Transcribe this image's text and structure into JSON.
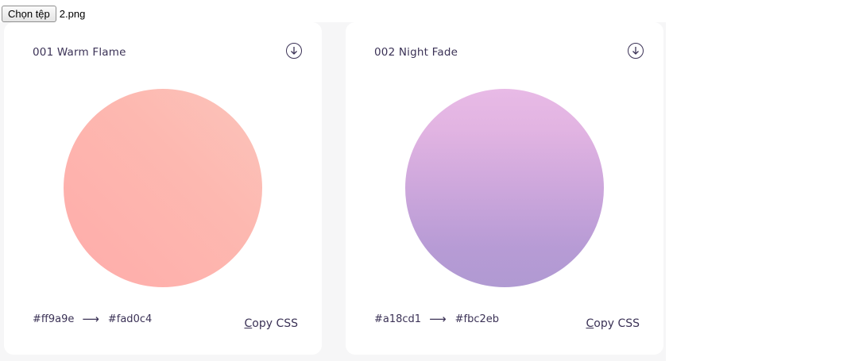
{
  "file_input": {
    "button_label": "Chọn tệp",
    "file_name": "2.png"
  },
  "cards": [
    {
      "title": "001 Warm Flame",
      "from_color": "#ff9a9e",
      "to_color": "#fad0c4",
      "arrow": "⟶",
      "copy_label_first": "C",
      "copy_label_rest": "opy CSS",
      "download_icon": "download-icon"
    },
    {
      "title": "002 Night Fade",
      "from_color": "#a18cd1",
      "to_color": "#fbc2eb",
      "arrow": "⟶",
      "copy_label_first": "C",
      "copy_label_rest": "opy CSS",
      "download_icon": "download-icon"
    }
  ],
  "colors": {
    "text": "#3b3256",
    "card_bg": "#ffffff",
    "stage_bg": "#f6f6f7"
  }
}
